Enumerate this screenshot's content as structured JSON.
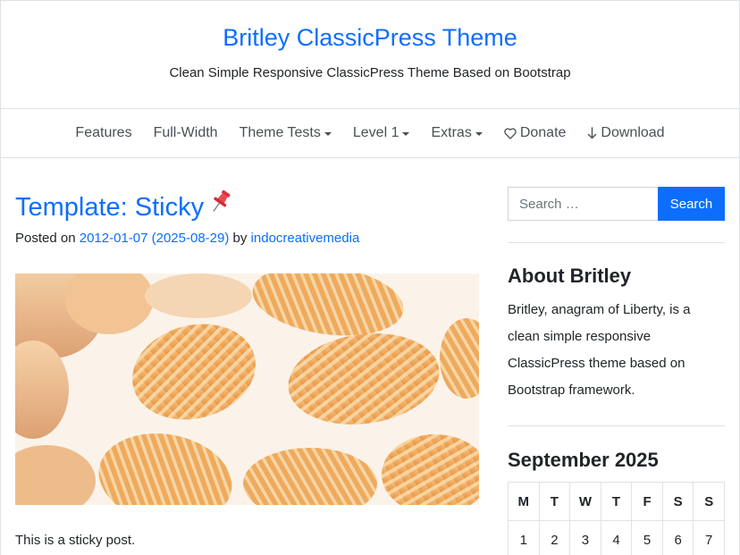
{
  "site": {
    "title": "Britley ClassicPress Theme",
    "description": "Clean Simple Responsive ClassicPress Theme Based on Bootstrap"
  },
  "nav": {
    "items": [
      {
        "label": "Features",
        "dropdown": false
      },
      {
        "label": "Full-Width",
        "dropdown": false
      },
      {
        "label": "Theme Tests",
        "dropdown": true
      },
      {
        "label": "Level 1",
        "dropdown": true
      },
      {
        "label": "Extras",
        "dropdown": true
      },
      {
        "label": "Donate",
        "icon": "heart-icon"
      },
      {
        "label": "Download",
        "icon": "arrow-down-icon"
      }
    ]
  },
  "post": {
    "title": "Template: Sticky",
    "title_icon": "pushpin-icon",
    "meta_prefix": "Posted on",
    "date": "2012-01-07 (2025-08-29)",
    "by": "by",
    "author": "indocreativemedia",
    "excerpt": "This is a sticky post."
  },
  "sidebar": {
    "search": {
      "placeholder": "Search …",
      "button": "Search"
    },
    "about": {
      "title": "About Britley",
      "text": "Britley, anagram of Liberty, is a clean simple responsive ClassicPress theme based on Bootstrap framework."
    },
    "calendar": {
      "title": "September 2025",
      "headers": [
        "M",
        "T",
        "W",
        "T",
        "F",
        "S",
        "S"
      ],
      "first_row": [
        "1",
        "2",
        "3",
        "4",
        "5",
        "6",
        "7"
      ]
    }
  },
  "colors": {
    "accent": "#0d6efd",
    "text": "#212529",
    "border": "#dee2e6"
  }
}
